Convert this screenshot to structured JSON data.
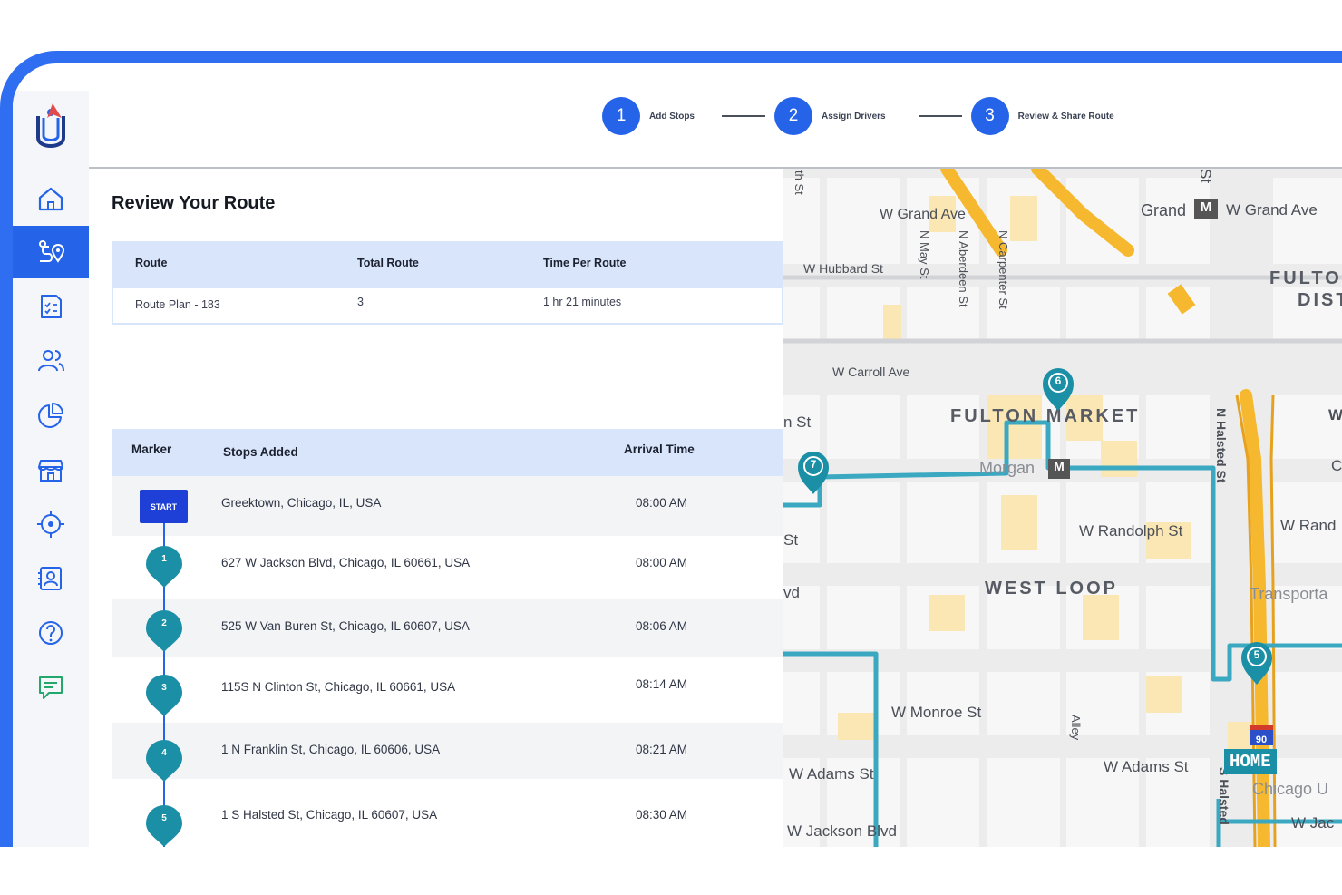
{
  "stepper": {
    "steps": [
      {
        "number": "1",
        "label": "Add Stops"
      },
      {
        "number": "2",
        "label": "Assign Drivers"
      },
      {
        "number": "3",
        "label": "Review & Share Route"
      }
    ]
  },
  "sidebar": {
    "active_index": 1,
    "items": [
      "home-icon",
      "route-planner-icon",
      "task-list-icon",
      "drivers-icon",
      "reports-icon",
      "store-icon",
      "location-target-icon",
      "contacts-icon",
      "help-icon",
      "feedback-icon"
    ]
  },
  "page": {
    "title": "Review Your Route"
  },
  "summary": {
    "headers": {
      "route": "Route",
      "total": "Total Route",
      "time": "Time Per Route"
    },
    "row": {
      "route": "Route Plan - 183",
      "total": "3",
      "time": "1 hr 21 minutes"
    }
  },
  "stops_table": {
    "headers": {
      "marker": "Marker",
      "stops": "Stops Added",
      "arrival": "Arrival Time"
    },
    "start_label": "START",
    "rows": [
      {
        "marker": "START",
        "address": "Greektown, Chicago, IL, USA",
        "time": "08:00 AM"
      },
      {
        "marker": "1",
        "address": "627 W Jackson Blvd, Chicago, IL 60661, USA",
        "time": "08:00 AM"
      },
      {
        "marker": "2",
        "address": "525 W Van Buren St, Chicago, IL 60607, USA",
        "time": "08:06 AM"
      },
      {
        "marker": "3",
        "address": "115S N Clinton St, Chicago, IL 60661, USA",
        "time": "08:14 AM"
      },
      {
        "marker": "4",
        "address": "1 N Franklin St, Chicago, IL 60606, USA",
        "time": "08:21 AM"
      },
      {
        "marker": "5",
        "address": "1 S Halsted St, Chicago, IL 60607, USA",
        "time": "08:30 AM"
      }
    ]
  },
  "map": {
    "streets": {
      "grand_ave_1": "W Grand Ave",
      "grand_station": "Grand",
      "grand_ave_2": "W Grand Ave",
      "hubbard": "W Hubbard St",
      "may": "N May St",
      "aberdeen": "N Aberdeen St",
      "carpenter": "N Carpenter St",
      "carroll": "W Carroll Ave",
      "n_st": "n St",
      "halsted_n": "N Halsted St",
      "morgan": "Morgan",
      "randolph": "W Randolph St",
      "rand_edge": "W Rand",
      "transporta": "Transporta",
      "monroe": "W Monroe St",
      "alley": "Alley",
      "adams_1": "W Adams St",
      "adams_2": "W Adams St",
      "jackson": "W Jackson Blvd",
      "jac_edge": "W Jac",
      "chicago_u": "Chicago U",
      "halsted_s": "S Halsted",
      "th_st": "th St",
      "st_edge": "St",
      "vd": "vd",
      "w_edge": "W",
      "c_edge": "C",
      "st_top": "St"
    },
    "districts": {
      "fulton_market": "FULTON MARKET",
      "west_loop": "WEST LOOP",
      "fulton_dist_1": "FULTO",
      "fulton_dist_2": "DIST"
    },
    "home_label": "HOME",
    "interstate": "90",
    "pins": [
      "5",
      "6",
      "7"
    ],
    "colors": {
      "route": "#3aa8c1",
      "pin": "#1b8fa6",
      "highway": "#f5b82e",
      "park": "#fbe7b3"
    }
  }
}
